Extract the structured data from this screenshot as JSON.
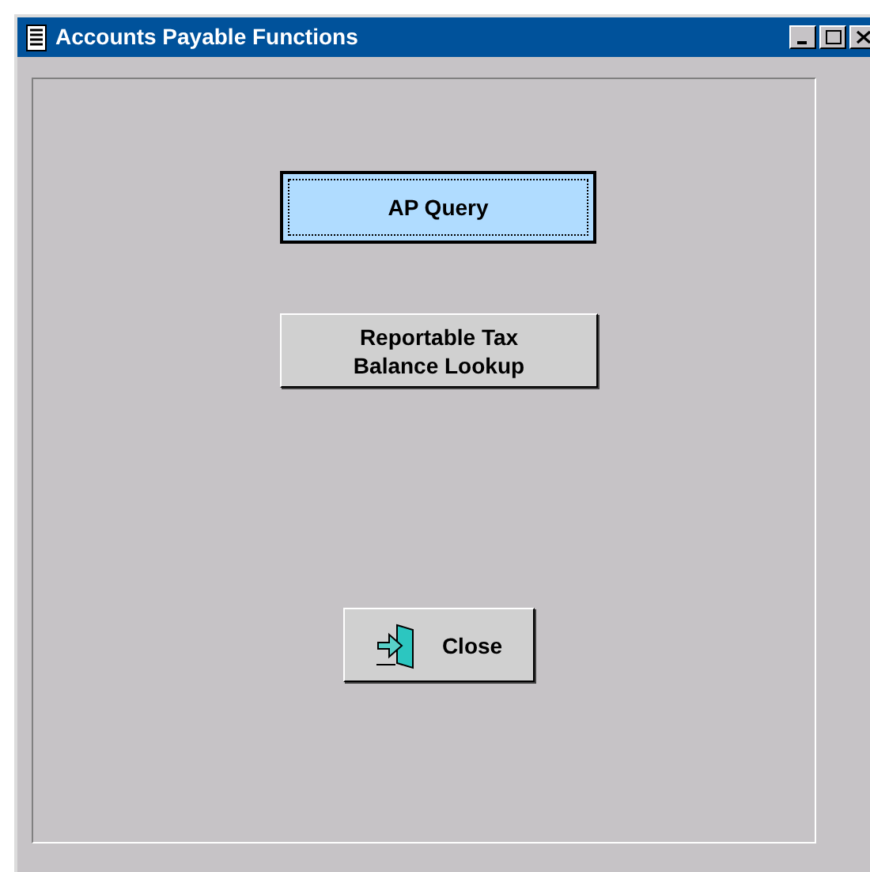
{
  "window": {
    "title": "Accounts Payable Functions"
  },
  "buttons": [
    {
      "kind": "text",
      "label": "AP Query",
      "selected": true
    },
    {
      "kind": "text",
      "label": "Reportable Tax\nBalance Lookup",
      "selected": false
    },
    {
      "kind": "exit",
      "label": "Close",
      "selected": false
    }
  ]
}
